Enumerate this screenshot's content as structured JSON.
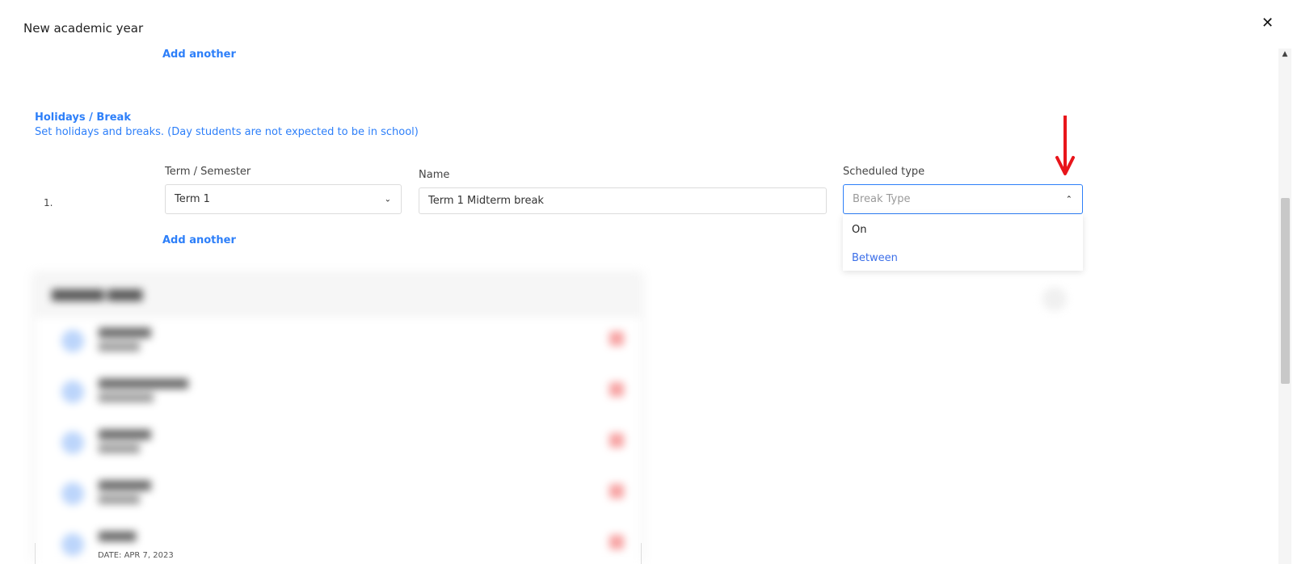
{
  "modal": {
    "title": "New academic year",
    "close_icon": "close-icon"
  },
  "links": {
    "add_another_top": "Add another",
    "add_another_bottom": "Add another"
  },
  "holidays": {
    "title": "Holidays / Break",
    "description": "Set holidays and breaks. (Day students are not expected to be in school)"
  },
  "row": {
    "number": "1.",
    "term_label": "Term / Semester",
    "term_value": "Term 1",
    "name_label": "Name",
    "name_value": "Term 1 Midterm break",
    "type_label": "Scheduled type",
    "type_placeholder": "Break Type"
  },
  "dropdown": {
    "options": [
      "On",
      "Between"
    ],
    "highlight_color": "#2d7ff9"
  },
  "background": {
    "date_text": "DATE: APR 7, 2023"
  },
  "colors": {
    "accent": "#2d7ff9",
    "arrow": "#e8151b"
  }
}
